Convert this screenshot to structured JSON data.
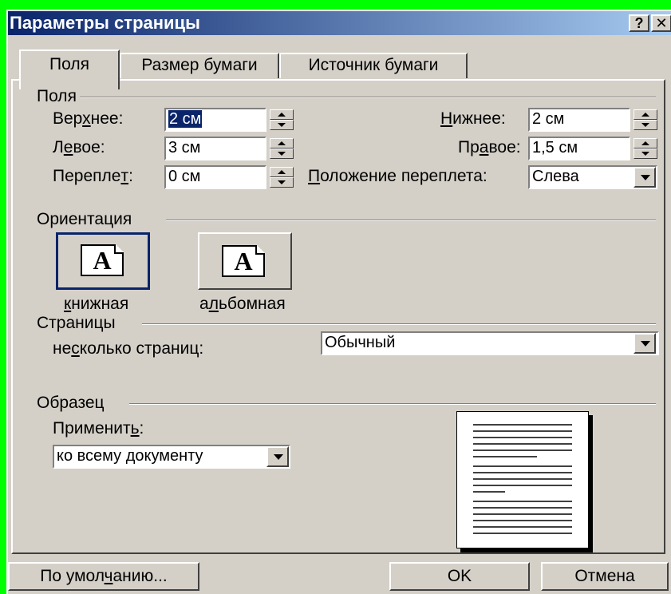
{
  "window": {
    "title": "Параметры страницы",
    "help_label": "?",
    "close_label": "✕"
  },
  "tabs": [
    {
      "label": "Поля"
    },
    {
      "label": "Размер бумаги"
    },
    {
      "label": "Источник бумаги"
    }
  ],
  "margins": {
    "group_label": "Поля",
    "top": {
      "label_pre": "Вер",
      "label_key": "х",
      "label_post": "нее:",
      "value": "2 см"
    },
    "bottom": {
      "label_pre": "",
      "label_key": "Н",
      "label_post": "ижнее:",
      "value": "2 см"
    },
    "left": {
      "label_pre": "Л",
      "label_key": "е",
      "label_post": "вое:",
      "value": "3 см"
    },
    "right": {
      "label_pre": "Пр",
      "label_key": "а",
      "label_post": "вое:",
      "value": "1,5 см"
    },
    "gutter": {
      "label_pre": "Переплe",
      "label_key": "т",
      "label_post": ":",
      "value": "0 см"
    },
    "gutter_pos": {
      "label_pre": "",
      "label_key": "П",
      "label_post": "оложение переплета:",
      "value": "Слева"
    }
  },
  "orientation": {
    "group_label": "Ориентация",
    "portrait": {
      "label_pre": "",
      "label_key": "к",
      "label_post": "нижная",
      "glyph": "A",
      "selected": true
    },
    "landscape": {
      "label_pre": "а",
      "label_key": "л",
      "label_post": "ьбомная",
      "glyph": "A",
      "selected": false
    }
  },
  "pages": {
    "group_label": "Страницы",
    "multiple_label_pre": "не",
    "multiple_label_key": "с",
    "multiple_label_post": "колько страниц:",
    "multiple_value": "Обычный"
  },
  "preview": {
    "group_label": "Образец",
    "apply_label_pre": "Применит",
    "apply_label_key": "ь",
    "apply_label_post": ":",
    "apply_value": "ко всему документу"
  },
  "buttons": {
    "default_pre": "По умол",
    "default_key": "ч",
    "default_post": "анию...",
    "ok": "OK",
    "cancel": "Отмена"
  }
}
